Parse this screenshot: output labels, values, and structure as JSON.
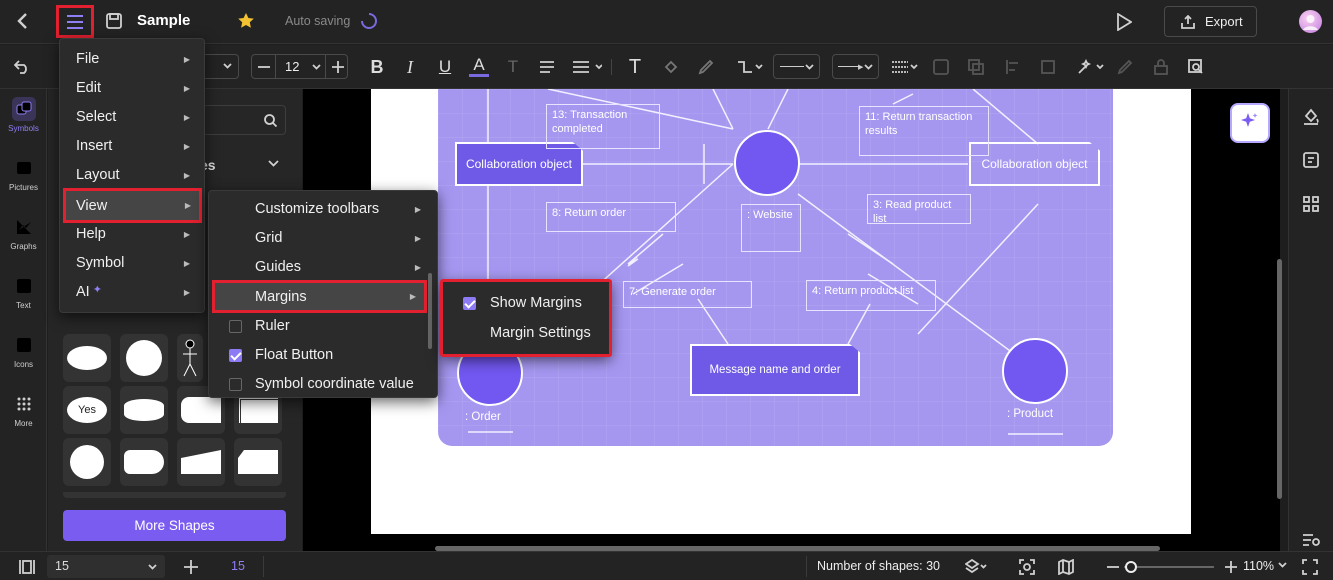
{
  "topbar": {
    "doc_title": "Sample",
    "status": "Auto saving",
    "export_label": "Export"
  },
  "toolbar": {
    "font_size": "12"
  },
  "rail": [
    {
      "label": "Symbols",
      "icon": "symbols-icon"
    },
    {
      "label": "Pictures",
      "icon": "pictures-icon"
    },
    {
      "label": "Graphs",
      "icon": "graphs-icon"
    },
    {
      "label": "Text",
      "icon": "text-icon"
    },
    {
      "label": "Icons",
      "icon": "icons-icon"
    },
    {
      "label": "More",
      "icon": "more-icon"
    }
  ],
  "panel": {
    "section_fragment": "es",
    "shape_labels": {
      "yes": "Yes"
    },
    "more_shapes": "More Shapes"
  },
  "main_menu": [
    {
      "label": "File"
    },
    {
      "label": "Edit"
    },
    {
      "label": "Select"
    },
    {
      "label": "Insert"
    },
    {
      "label": "Layout"
    },
    {
      "label": "View"
    },
    {
      "label": "Help"
    },
    {
      "label": "Symbol"
    },
    {
      "label": "AI"
    }
  ],
  "view_menu": [
    {
      "label": "Customize toolbars",
      "type": "submenu"
    },
    {
      "label": "Grid",
      "type": "submenu"
    },
    {
      "label": "Guides",
      "type": "submenu"
    },
    {
      "label": "Margins",
      "type": "submenu"
    },
    {
      "label": "Ruler",
      "type": "check",
      "checked": false
    },
    {
      "label": "Float Button",
      "type": "check",
      "checked": true
    },
    {
      "label": "Symbol coordinate value",
      "type": "check",
      "checked": false
    }
  ],
  "margins_menu": [
    {
      "label": "Show Margins",
      "checked": true
    },
    {
      "label": "Margin Settings"
    }
  ],
  "diagram": {
    "collab_left": "Collaboration object",
    "collab_right": "Collaboration object",
    "website": ": Website",
    "order": ": Order",
    "product": ": Product",
    "message": "Message name and order",
    "m13a": "13: Transaction",
    "m13b": "completed",
    "m11a": "11: Return transaction",
    "m11b": "results",
    "m8": "8: Return order",
    "m3": "3: Read product list",
    "m7": "7: Generate order",
    "m4": "4: Return product list"
  },
  "status": {
    "page_select": "15",
    "page_num": "15",
    "shape_count": "Number of shapes: 30",
    "zoom": "110%"
  },
  "colors": {
    "accent": "#7a5cf0",
    "highlight": "#e2202f",
    "diagram_bg": "#a597f0"
  }
}
